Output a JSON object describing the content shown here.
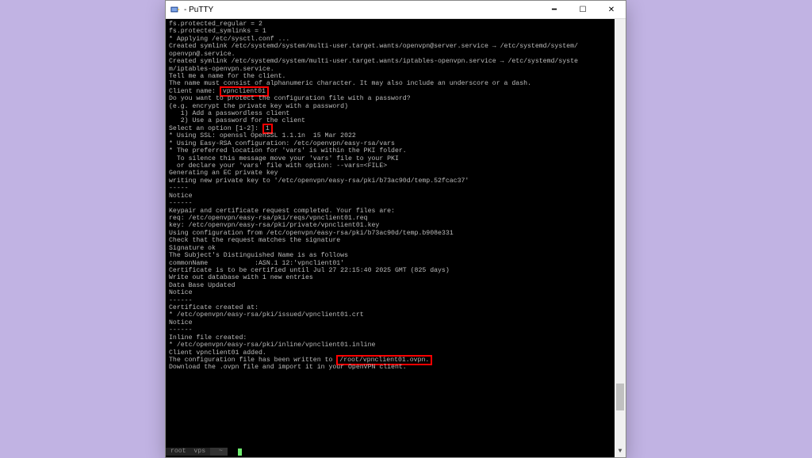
{
  "window": {
    "title": "                - PuTTY",
    "minimize": "━",
    "maximize": "☐",
    "close": "✕"
  },
  "highlights": {
    "client_name": "vpnclient01",
    "option": "1",
    "outpath": "/root/vpnclient01.ovpn."
  },
  "terminal_lines_pre": [
    "fs.protected_regular = 2",
    "fs.protected_symlinks = 1",
    "* Applying /etc/sysctl.conf ...",
    "Created symlink /etc/systemd/system/multi-user.target.wants/openvpn@server.service → /etc/systemd/system/",
    "openvpn@.service.",
    "Created symlink /etc/systemd/system/multi-user.target.wants/iptables-openvpn.service → /etc/systemd/syste",
    "m/iptables-openvpn.service.",
    "",
    "Tell me a name for the client.",
    "The name must consist of alphanumeric character. It may also include an underscore or a dash."
  ],
  "client_name_prefix": "Client name: ",
  "terminal_lines_mid1": [
    "",
    "Do you want to protect the configuration file with a password?",
    "(e.g. encrypt the private key with a password)",
    "   1) Add a passwordless client",
    "   2) Use a password for the client"
  ],
  "option_prefix": "Select an option [1-2]: ",
  "terminal_lines_mid2": [
    "",
    "* Using SSL: openssl OpenSSL 1.1.1n  15 Mar 2022",
    "",
    "* Using Easy-RSA configuration: /etc/openvpn/easy-rsa/vars",
    "",
    "* The preferred location for 'vars' is within the PKI folder.",
    "  To silence this message move your 'vars' file to your PKI",
    "  or declare your 'vars' file with option: --vars=<FILE>",
    "Generating an EC private key",
    "writing new private key to '/etc/openvpn/easy-rsa/pki/b73ac90d/temp.52fcac37'",
    "-----",
    "",
    "Notice",
    "------",
    "Keypair and certificate request completed. Your files are:",
    "req: /etc/openvpn/easy-rsa/pki/reqs/vpnclient01.req",
    "key: /etc/openvpn/easy-rsa/pki/private/vpnclient01.key",
    "Using configuration from /etc/openvpn/easy-rsa/pki/b73ac90d/temp.b908e331",
    "Check that the request matches the signature",
    "Signature ok",
    "The Subject's Distinguished Name is as follows",
    "commonName            :ASN.1 12:'vpnclient01'",
    "Certificate is to be certified until Jul 27 22:15:40 2025 GMT (825 days)",
    "",
    "Write out database with 1 new entries",
    "Data Base Updated",
    "",
    "Notice",
    "------",
    "Certificate created at:",
    "* /etc/openvpn/easy-rsa/pki/issued/vpnclient01.crt",
    "",
    "Notice",
    "------",
    "Inline file created:",
    "* /etc/openvpn/easy-rsa/pki/inline/vpnclient01.inline",
    "Client vpnclient01 added.",
    ""
  ],
  "outpath_prefix": "The configuration file has been written to ",
  "terminal_lines_post": [
    "Download the .ovpn file and import it in your OpenVPN client."
  ],
  "prompt": {
    "userhost": " root  vps ",
    "path": "  ~ ",
    "tail": "  "
  }
}
